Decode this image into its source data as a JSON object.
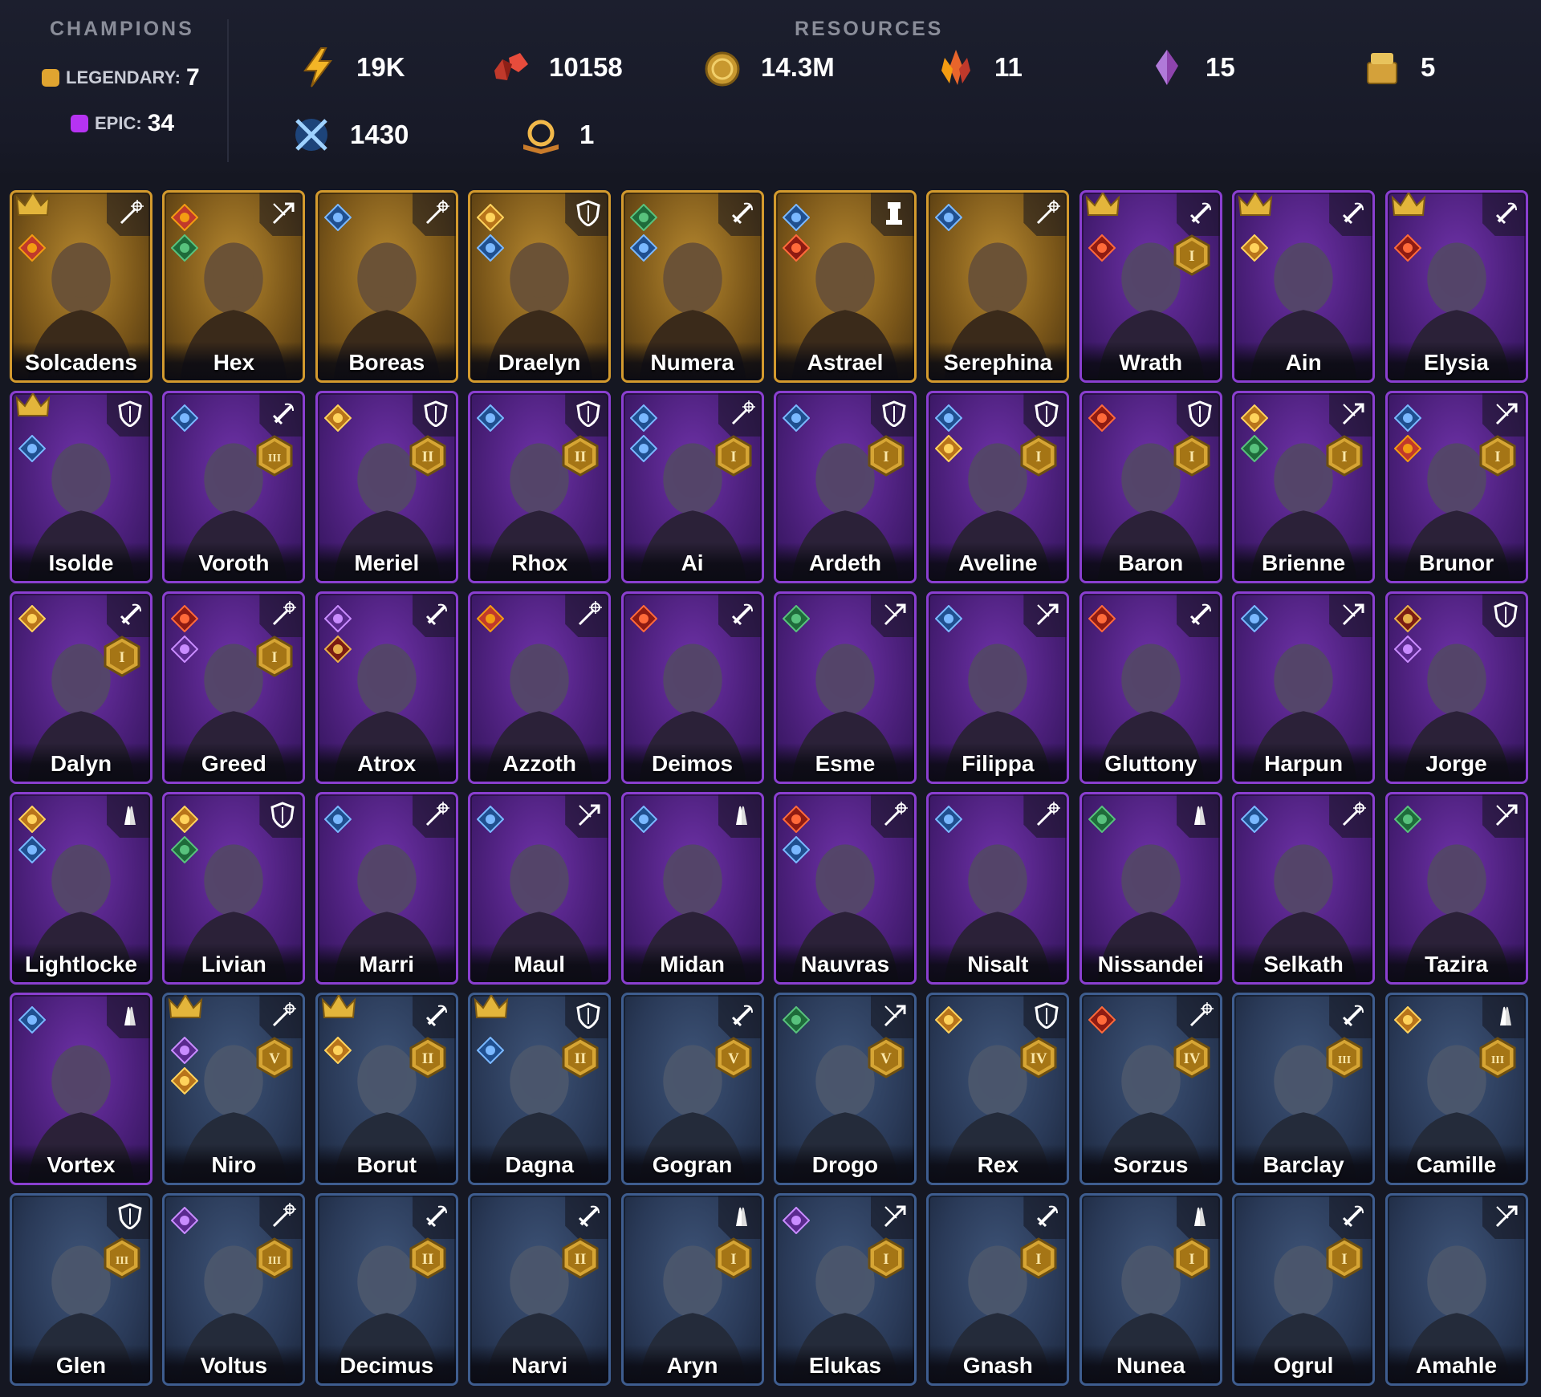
{
  "header": {
    "champions_title": "CHAMPIONS",
    "resources_title": "RESOURCES",
    "legendary_label": "LEGENDARY:",
    "legendary_count": "7",
    "epic_label": "EPIC:",
    "epic_count": "34"
  },
  "resources": [
    {
      "icon": "energy-bolt-icon",
      "value": "19K"
    },
    {
      "icon": "ruby-gems-icon",
      "value": "10158"
    },
    {
      "icon": "gold-coin-icon",
      "value": "14.3M"
    },
    {
      "icon": "fire-shard-icon",
      "value": "11"
    },
    {
      "icon": "void-shard-icon",
      "value": "15"
    },
    {
      "icon": "gold-chest-icon",
      "value": "5"
    },
    {
      "icon": "crossed-swords-token-icon",
      "value": "1430"
    },
    {
      "icon": "tome-icon",
      "value": "1"
    }
  ],
  "colors": {
    "legendary": "#e0a430",
    "epic": "#b633f2",
    "rare": "#3e5d8f",
    "background": "#151722"
  },
  "champions": [
    {
      "name": "Solcadens",
      "rarity": "legendary",
      "role": "mage-icon",
      "crown": true,
      "factions": [
        "fire"
      ],
      "rank": ""
    },
    {
      "name": "Hex",
      "rarity": "legendary",
      "role": "ranger-icon",
      "crown": false,
      "factions": [
        "fire",
        "nature"
      ],
      "rank": ""
    },
    {
      "name": "Boreas",
      "rarity": "legendary",
      "role": "mage-icon",
      "crown": false,
      "factions": [
        "water"
      ],
      "rank": ""
    },
    {
      "name": "Draelyn",
      "rarity": "legendary",
      "role": "tank-icon",
      "crown": false,
      "factions": [
        "sun",
        "water"
      ],
      "rank": ""
    },
    {
      "name": "Numera",
      "rarity": "legendary",
      "role": "warrior-icon",
      "crown": false,
      "factions": [
        "nature",
        "water"
      ],
      "rank": ""
    },
    {
      "name": "Astrael",
      "rarity": "legendary",
      "role": "chess-rook-icon",
      "crown": false,
      "factions": [
        "water",
        "blood"
      ],
      "rank": ""
    },
    {
      "name": "Serephina",
      "rarity": "legendary",
      "role": "mage-icon",
      "crown": false,
      "factions": [
        "water"
      ],
      "rank": ""
    },
    {
      "name": "Wrath",
      "rarity": "epic",
      "role": "warrior-icon",
      "crown": true,
      "factions": [
        "blood"
      ],
      "rank": "I"
    },
    {
      "name": "Ain",
      "rarity": "epic",
      "role": "warrior-icon",
      "crown": true,
      "factions": [
        "sun"
      ],
      "rank": ""
    },
    {
      "name": "Elysia",
      "rarity": "epic",
      "role": "warrior-icon",
      "crown": true,
      "factions": [
        "blood"
      ],
      "rank": ""
    },
    {
      "name": "Isolde",
      "rarity": "epic",
      "role": "tank-icon",
      "crown": true,
      "factions": [
        "water"
      ],
      "rank": ""
    },
    {
      "name": "Voroth",
      "rarity": "epic",
      "role": "warrior-icon",
      "crown": false,
      "factions": [
        "water"
      ],
      "rank": "III"
    },
    {
      "name": "Meriel",
      "rarity": "epic",
      "role": "tank-icon",
      "crown": false,
      "factions": [
        "sun"
      ],
      "rank": "II"
    },
    {
      "name": "Rhox",
      "rarity": "epic",
      "role": "tank-icon",
      "crown": false,
      "factions": [
        "water"
      ],
      "rank": "II"
    },
    {
      "name": "Ai",
      "rarity": "epic",
      "role": "mage-icon",
      "crown": false,
      "factions": [
        "water",
        "water"
      ],
      "rank": "I"
    },
    {
      "name": "Ardeth",
      "rarity": "epic",
      "role": "tank-icon",
      "crown": false,
      "factions": [
        "water"
      ],
      "rank": "I"
    },
    {
      "name": "Aveline",
      "rarity": "epic",
      "role": "tank-icon",
      "crown": false,
      "factions": [
        "water",
        "sun"
      ],
      "rank": "I"
    },
    {
      "name": "Baron",
      "rarity": "epic",
      "role": "tank-icon",
      "crown": false,
      "factions": [
        "blood"
      ],
      "rank": "I"
    },
    {
      "name": "Brienne",
      "rarity": "epic",
      "role": "ranger-icon",
      "crown": false,
      "factions": [
        "sun",
        "nature"
      ],
      "rank": "I"
    },
    {
      "name": "Brunor",
      "rarity": "epic",
      "role": "ranger-icon",
      "crown": false,
      "factions": [
        "water",
        "fire"
      ],
      "rank": "I"
    },
    {
      "name": "Dalyn",
      "rarity": "epic",
      "role": "warrior-icon",
      "crown": false,
      "factions": [
        "sun"
      ],
      "rank": "I"
    },
    {
      "name": "Greed",
      "rarity": "epic",
      "role": "mage-icon",
      "crown": false,
      "factions": [
        "blood",
        "void"
      ],
      "rank": "I"
    },
    {
      "name": "Atrox",
      "rarity": "epic",
      "role": "warrior-icon",
      "crown": false,
      "factions": [
        "void",
        "war"
      ],
      "rank": ""
    },
    {
      "name": "Azzoth",
      "rarity": "epic",
      "role": "mage-icon",
      "crown": false,
      "factions": [
        "fire"
      ],
      "rank": ""
    },
    {
      "name": "Deimos",
      "rarity": "epic",
      "role": "warrior-icon",
      "crown": false,
      "factions": [
        "blood"
      ],
      "rank": ""
    },
    {
      "name": "Esme",
      "rarity": "epic",
      "role": "ranger-icon",
      "crown": false,
      "factions": [
        "nature"
      ],
      "rank": ""
    },
    {
      "name": "Filippa",
      "rarity": "epic",
      "role": "ranger-icon",
      "crown": false,
      "factions": [
        "water"
      ],
      "rank": ""
    },
    {
      "name": "Gluttony",
      "rarity": "epic",
      "role": "warrior-icon",
      "crown": false,
      "factions": [
        "blood"
      ],
      "rank": ""
    },
    {
      "name": "Harpun",
      "rarity": "epic",
      "role": "ranger-icon",
      "crown": false,
      "factions": [
        "water"
      ],
      "rank": ""
    },
    {
      "name": "Jorge",
      "rarity": "epic",
      "role": "tank-icon",
      "crown": false,
      "factions": [
        "war",
        "void"
      ],
      "rank": ""
    },
    {
      "name": "Lightlocke",
      "rarity": "epic",
      "role": "support-icon",
      "crown": false,
      "factions": [
        "sun",
        "water"
      ],
      "rank": ""
    },
    {
      "name": "Livian",
      "rarity": "epic",
      "role": "tank-icon",
      "crown": false,
      "factions": [
        "sun",
        "nature"
      ],
      "rank": ""
    },
    {
      "name": "Marri",
      "rarity": "epic",
      "role": "mage-icon",
      "crown": false,
      "factions": [
        "water"
      ],
      "rank": ""
    },
    {
      "name": "Maul",
      "rarity": "epic",
      "role": "ranger-icon",
      "crown": false,
      "factions": [
        "water"
      ],
      "rank": ""
    },
    {
      "name": "Midan",
      "rarity": "epic",
      "role": "support-icon",
      "crown": false,
      "factions": [
        "water"
      ],
      "rank": ""
    },
    {
      "name": "Nauvras",
      "rarity": "epic",
      "role": "mage-icon",
      "crown": false,
      "factions": [
        "blood",
        "water"
      ],
      "rank": ""
    },
    {
      "name": "Nisalt",
      "rarity": "epic",
      "role": "mage-icon",
      "crown": false,
      "factions": [
        "water"
      ],
      "rank": ""
    },
    {
      "name": "Nissandei",
      "rarity": "epic",
      "role": "support-icon",
      "crown": false,
      "factions": [
        "nature"
      ],
      "rank": ""
    },
    {
      "name": "Selkath",
      "rarity": "epic",
      "role": "mage-icon",
      "crown": false,
      "factions": [
        "water"
      ],
      "rank": ""
    },
    {
      "name": "Tazira",
      "rarity": "epic",
      "role": "ranger-icon",
      "crown": false,
      "factions": [
        "nature"
      ],
      "rank": ""
    },
    {
      "name": "Vortex",
      "rarity": "epic",
      "role": "support-icon",
      "crown": false,
      "factions": [
        "water"
      ],
      "rank": ""
    },
    {
      "name": "Niro",
      "rarity": "rare",
      "role": "mage-icon",
      "crown": true,
      "factions": [
        "void",
        "sun"
      ],
      "rank": "V"
    },
    {
      "name": "Borut",
      "rarity": "rare",
      "role": "warrior-icon",
      "crown": true,
      "factions": [
        "sun"
      ],
      "rank": "II"
    },
    {
      "name": "Dagna",
      "rarity": "rare",
      "role": "tank-icon",
      "crown": true,
      "factions": [
        "water"
      ],
      "rank": "II"
    },
    {
      "name": "Gogran",
      "rarity": "rare",
      "role": "warrior-icon",
      "crown": false,
      "factions": [],
      "rank": "V"
    },
    {
      "name": "Drogo",
      "rarity": "rare",
      "role": "ranger-icon",
      "crown": false,
      "factions": [
        "nature"
      ],
      "rank": "V"
    },
    {
      "name": "Rex",
      "rarity": "rare",
      "role": "tank-icon",
      "crown": false,
      "factions": [
        "sun"
      ],
      "rank": "IV"
    },
    {
      "name": "Sorzus",
      "rarity": "rare",
      "role": "mage-icon",
      "crown": false,
      "factions": [
        "blood"
      ],
      "rank": "IV"
    },
    {
      "name": "Barclay",
      "rarity": "rare",
      "role": "warrior-icon",
      "crown": false,
      "factions": [],
      "rank": "III"
    },
    {
      "name": "Camille",
      "rarity": "rare",
      "role": "support-icon",
      "crown": false,
      "factions": [
        "sun"
      ],
      "rank": "III"
    },
    {
      "name": "Glen",
      "rarity": "rare",
      "role": "tank-icon",
      "crown": false,
      "factions": [],
      "rank": "III"
    },
    {
      "name": "Voltus",
      "rarity": "rare",
      "role": "mage-icon",
      "crown": false,
      "factions": [
        "void"
      ],
      "rank": "III"
    },
    {
      "name": "Decimus",
      "rarity": "rare",
      "role": "warrior-icon",
      "crown": false,
      "factions": [],
      "rank": "II"
    },
    {
      "name": "Narvi",
      "rarity": "rare",
      "role": "warrior-icon",
      "crown": false,
      "factions": [],
      "rank": "II"
    },
    {
      "name": "Aryn",
      "rarity": "rare",
      "role": "support-icon",
      "crown": false,
      "factions": [],
      "rank": "I"
    },
    {
      "name": "Elukas",
      "rarity": "rare",
      "role": "ranger-icon",
      "crown": false,
      "factions": [
        "void"
      ],
      "rank": "I"
    },
    {
      "name": "Gnash",
      "rarity": "rare",
      "role": "warrior-icon",
      "crown": false,
      "factions": [],
      "rank": "I"
    },
    {
      "name": "Nunea",
      "rarity": "rare",
      "role": "support-icon",
      "crown": false,
      "factions": [],
      "rank": "I"
    },
    {
      "name": "Ogrul",
      "rarity": "rare",
      "role": "warrior-icon",
      "crown": false,
      "factions": [],
      "rank": "I"
    },
    {
      "name": "Amahle",
      "rarity": "rare",
      "role": "ranger-icon",
      "crown": false,
      "factions": [],
      "rank": ""
    }
  ]
}
